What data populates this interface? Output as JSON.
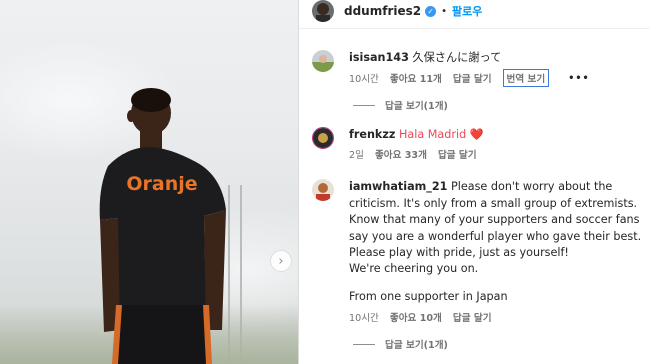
{
  "post": {
    "username": "ddumfries2",
    "follow_label": "팔로우",
    "shirt_text": "Oranje",
    "next_glyph": "›"
  },
  "comments": [
    {
      "username": "isisan143",
      "text": "久保さんに謝って",
      "time": "10시간",
      "likes": "좋아요 11개",
      "reply": "답글 달기",
      "translate": "번역 보기",
      "more": "•••",
      "replies": "답글 보기(1개)"
    },
    {
      "username": "frenkzz",
      "text": "Hala Madrid ❤️",
      "time": "2일",
      "likes": "좋아요 33개",
      "reply": "답글 달기"
    },
    {
      "username": "iamwhatiam_21",
      "text": "Please don't worry about the criticism. It's only from a small group of extremists. Know that many of your supporters and soccer fans say you are a wonderful player who gave their best. Please play with pride, just as yourself!",
      "text2": "We're cheering you on.",
      "text3": "From one supporter in Japan",
      "time": "10시간",
      "likes": "좋아요 10개",
      "reply": "답글 달기",
      "replies": "답글 보기(1개)"
    }
  ],
  "colors": {
    "accent": "#0095f6",
    "verified": "#3897f0",
    "shirt": "#1c1c1e",
    "shirt_text": "#e8742a"
  }
}
